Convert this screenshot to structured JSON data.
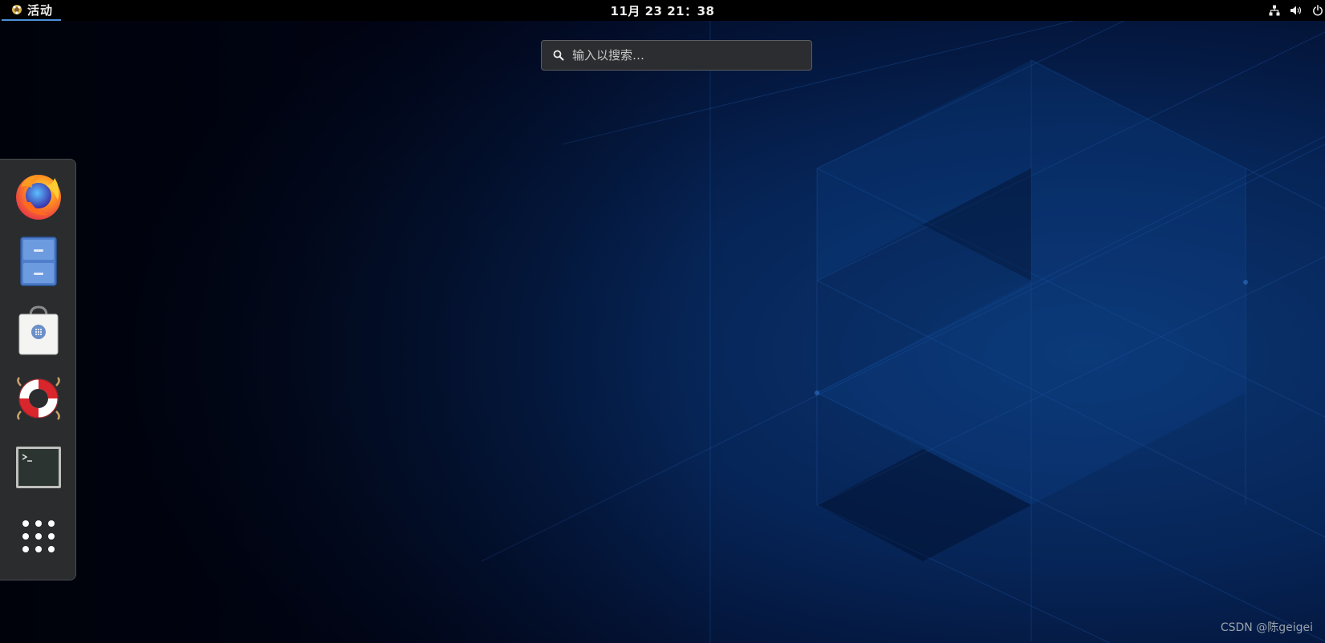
{
  "topbar": {
    "activities_label": "活动",
    "clock": "11月 23  21：38",
    "tray_icons": [
      "network-wired-icon",
      "audio-volume-icon",
      "system-power-icon"
    ]
  },
  "search": {
    "placeholder": "输入以搜索…",
    "icon": "search-icon"
  },
  "dash": {
    "items": [
      {
        "name": "firefox",
        "icon": "firefox-icon"
      },
      {
        "name": "files",
        "icon": "file-cabinet-icon"
      },
      {
        "name": "software",
        "icon": "shopping-bag-icon"
      },
      {
        "name": "help",
        "icon": "lifebuoy-icon"
      },
      {
        "name": "terminal",
        "icon": "terminal-icon"
      },
      {
        "name": "show-applications",
        "icon": "grid-dots-icon"
      }
    ]
  },
  "watermark": "CSDN @陈geigei",
  "colors": {
    "topbar": "#000000",
    "activities_underline": "#4a90d9",
    "dash_background": "#2a2c2e",
    "wallpaper_dark": "#020618",
    "wallpaper_blue": "#0d3a7a"
  }
}
